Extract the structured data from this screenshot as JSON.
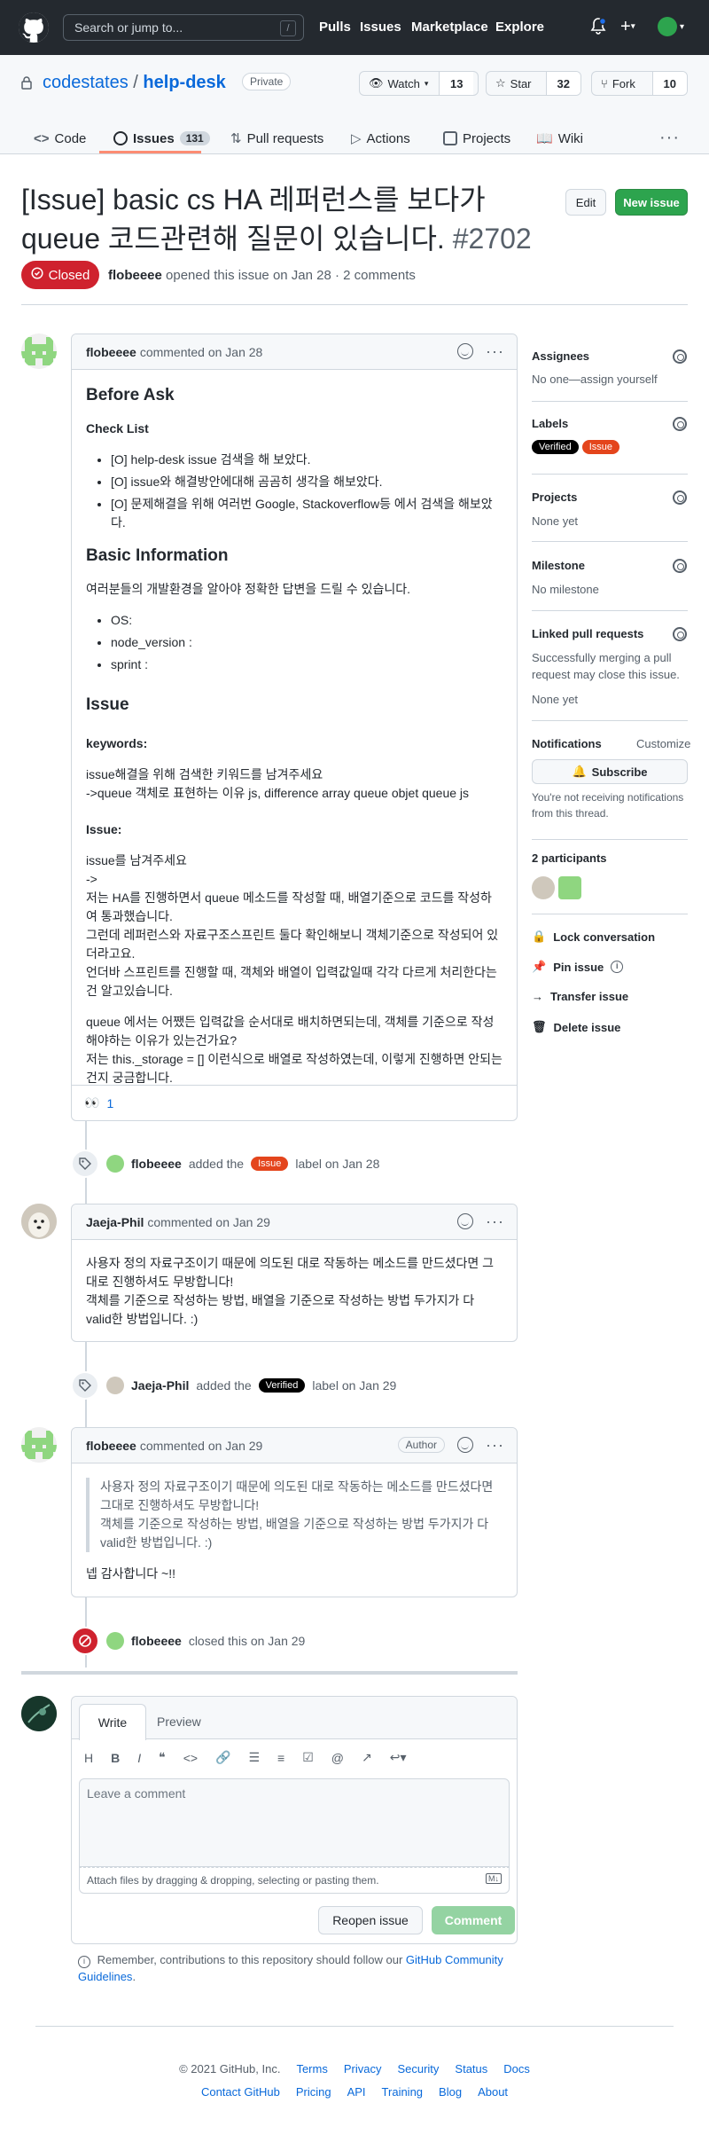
{
  "header": {
    "search_placeholder": "Search or jump to...",
    "search_key": "/",
    "nav": [
      "Pulls",
      "Issues",
      "Marketplace",
      "Explore"
    ]
  },
  "repo": {
    "owner": "codestates",
    "sep": "/",
    "name": "help-desk",
    "visibility": "Private",
    "watch": {
      "label": "Watch",
      "count": "13"
    },
    "star": {
      "label": "Star",
      "count": "32"
    },
    "fork": {
      "label": "Fork",
      "count": "10"
    }
  },
  "tabs": [
    {
      "label": "Code"
    },
    {
      "label": "Issues",
      "count": "131"
    },
    {
      "label": "Pull requests"
    },
    {
      "label": "Actions"
    },
    {
      "label": "Projects"
    },
    {
      "label": "Wiki"
    }
  ],
  "issue": {
    "title": "[Issue] basic cs HA 레퍼런스를 보다가 queue 코드관련해 질문이 있습니다.",
    "number": "#2702",
    "edit_label": "Edit",
    "new_label": "New issue",
    "state": "Closed",
    "author": "flobeeee",
    "meta_rest": "opened this issue on Jan 28 · 2 comments"
  },
  "comment1": {
    "author": "flobeeee",
    "when": "commented on Jan 28",
    "h_before": "Before Ask",
    "h_check": "Check List",
    "checks": [
      "[O] help-desk issue 검색을 해 보았다.",
      "[O] issue와 해결방안에대해 곰곰히 생각을 해보았다.",
      "[O] 문제해결을 위해 여러번 Google, Stackoverflow등 에서 검색을 해보았다."
    ],
    "h_basic": "Basic Information",
    "basic_intro": "여러분들의 개발환경을 알아야 정확한 답변을 드릴 수 있습니다.",
    "basic_items": [
      "OS:",
      "node_version :",
      "sprint :"
    ],
    "h_issue": "Issue",
    "h_keywords": "keywords:",
    "kw1": "issue해결을 위해 검색한 키워드를 남겨주세요",
    "kw2": "->queue 객체로 표현하는 이유 js, difference array queue objet queue js",
    "h_issue2": "Issue:",
    "i1": "issue를 남겨주세요",
    "i2": "->",
    "i3": "저는 HA를 진행하면서 queue 메소드를 작성할 때, 배열기준으로 코드를 작성하여 통과했습니다.",
    "i4": "그런데 레퍼런스와 자료구조스프린트 둘다 확인해보니 객체기준으로 작성되어 있더라고요.",
    "i5": "언더바 스프린트를 진행할 때, 객체와 배열이 입력값일때 각각 다르게 처리한다는 건 알고있습니다.",
    "p1": "queue 에서는 어쨌든 입력값을 순서대로 배치하면되는데, 객체를 기준으로 작성해야하는 이유가 있는건가요?",
    "p2": "저는 this._storage = [] 이런식으로 배열로 작성하였는데, 이렇게 진행하면 안되는 건지 궁금합니다.",
    "reaction": "👀",
    "reaction_count": "1"
  },
  "event1": {
    "actor": "flobeeee",
    "pre": "added the",
    "label": "Issue",
    "post": "label on Jan 28"
  },
  "comment2": {
    "author": "Jaeja-Phil",
    "when": "commented on Jan 29",
    "l1": "사용자 정의 자료구조이기 때문에 의도된 대로 작동하는 메소드를 만드셨다면 그대로 진행하셔도 무방합니다!",
    "l2": "객체를 기준으로 작성하는 방법, 배열을 기준으로 작성하는 방법 두가지가 다 valid한 방법입니다. :)"
  },
  "event2": {
    "actor": "Jaeja-Phil",
    "pre": "added the",
    "label": "Verified",
    "post": "label on Jan 29"
  },
  "comment3": {
    "author": "flobeeee",
    "when": "commented on Jan 29",
    "badge": "Author",
    "q1": "사용자 정의 자료구조이기 때문에 의도된 대로 작동하는 메소드를 만드셨다면 그대로 진행하셔도 무방합니다!",
    "q2": "객체를 기준으로 작성하는 방법, 배열을 기준으로 작성하는 방법 두가지가 다 valid한 방법입니다. :)",
    "reply": "넵 감사합니다 ~!!"
  },
  "event3": {
    "actor": "flobeeee",
    "post": "closed this on Jan 29"
  },
  "editor": {
    "tab_write": "Write",
    "tab_preview": "Preview",
    "placeholder": "Leave a comment",
    "attach": "Attach files by dragging & dropping, selecting or pasting them.",
    "reopen": "Reopen issue",
    "comment": "Comment",
    "note_pre": "Remember, contributions to this repository should follow our",
    "note_link": "GitHub Community Guidelines",
    "note_post": "."
  },
  "sidebar": {
    "assignees": "Assignees",
    "assignees_val": "No one—assign yourself",
    "labels": "Labels",
    "label_verified": "Verified",
    "label_issue": "Issue",
    "projects": "Projects",
    "projects_val": "None yet",
    "milestone": "Milestone",
    "milestone_val": "No milestone",
    "linked": "Linked pull requests",
    "linked_desc": "Successfully merging a pull request may close this issue.",
    "linked_val": "None yet",
    "notifications": "Notifications",
    "customize": "Customize",
    "subscribe": "Subscribe",
    "notif_desc": "You're not receiving notifications from this thread.",
    "participants": "2 participants",
    "lock": "Lock conversation",
    "pin": "Pin issue",
    "transfer": "Transfer issue",
    "delete": "Delete issue"
  },
  "footer": {
    "copyright": "© 2021 GitHub, Inc.",
    "row1": [
      "Terms",
      "Privacy",
      "Security",
      "Status",
      "Docs"
    ],
    "row2": [
      "Contact GitHub",
      "Pricing",
      "API",
      "Training",
      "Blog",
      "About"
    ]
  },
  "colors": {
    "label_verified": "#000000",
    "label_issue": "#e4451c",
    "closed": "#cf222e",
    "green": "#2da44e"
  }
}
